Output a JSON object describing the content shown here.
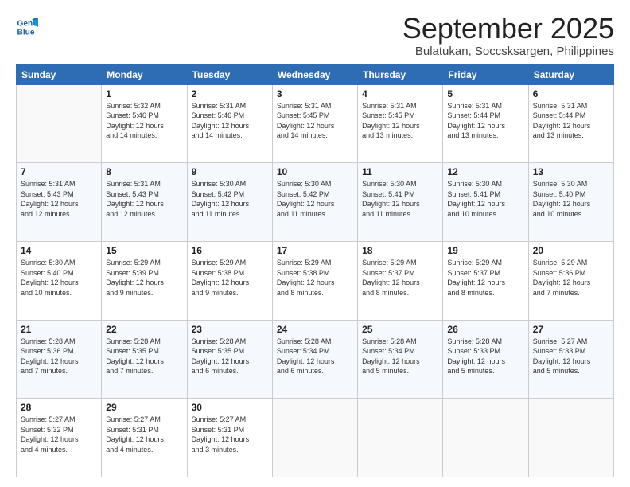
{
  "logo": {
    "line1": "General",
    "line2": "Blue"
  },
  "title": "September 2025",
  "subtitle": "Bulatukan, Soccsksargen, Philippines",
  "days_header": [
    "Sunday",
    "Monday",
    "Tuesday",
    "Wednesday",
    "Thursday",
    "Friday",
    "Saturday"
  ],
  "weeks": [
    [
      {
        "num": "",
        "info": ""
      },
      {
        "num": "1",
        "info": "Sunrise: 5:32 AM\nSunset: 5:46 PM\nDaylight: 12 hours\nand 14 minutes."
      },
      {
        "num": "2",
        "info": "Sunrise: 5:31 AM\nSunset: 5:46 PM\nDaylight: 12 hours\nand 14 minutes."
      },
      {
        "num": "3",
        "info": "Sunrise: 5:31 AM\nSunset: 5:45 PM\nDaylight: 12 hours\nand 14 minutes."
      },
      {
        "num": "4",
        "info": "Sunrise: 5:31 AM\nSunset: 5:45 PM\nDaylight: 12 hours\nand 13 minutes."
      },
      {
        "num": "5",
        "info": "Sunrise: 5:31 AM\nSunset: 5:44 PM\nDaylight: 12 hours\nand 13 minutes."
      },
      {
        "num": "6",
        "info": "Sunrise: 5:31 AM\nSunset: 5:44 PM\nDaylight: 12 hours\nand 13 minutes."
      }
    ],
    [
      {
        "num": "7",
        "info": "Sunrise: 5:31 AM\nSunset: 5:43 PM\nDaylight: 12 hours\nand 12 minutes."
      },
      {
        "num": "8",
        "info": "Sunrise: 5:31 AM\nSunset: 5:43 PM\nDaylight: 12 hours\nand 12 minutes."
      },
      {
        "num": "9",
        "info": "Sunrise: 5:30 AM\nSunset: 5:42 PM\nDaylight: 12 hours\nand 11 minutes."
      },
      {
        "num": "10",
        "info": "Sunrise: 5:30 AM\nSunset: 5:42 PM\nDaylight: 12 hours\nand 11 minutes."
      },
      {
        "num": "11",
        "info": "Sunrise: 5:30 AM\nSunset: 5:41 PM\nDaylight: 12 hours\nand 11 minutes."
      },
      {
        "num": "12",
        "info": "Sunrise: 5:30 AM\nSunset: 5:41 PM\nDaylight: 12 hours\nand 10 minutes."
      },
      {
        "num": "13",
        "info": "Sunrise: 5:30 AM\nSunset: 5:40 PM\nDaylight: 12 hours\nand 10 minutes."
      }
    ],
    [
      {
        "num": "14",
        "info": "Sunrise: 5:30 AM\nSunset: 5:40 PM\nDaylight: 12 hours\nand 10 minutes."
      },
      {
        "num": "15",
        "info": "Sunrise: 5:29 AM\nSunset: 5:39 PM\nDaylight: 12 hours\nand 9 minutes."
      },
      {
        "num": "16",
        "info": "Sunrise: 5:29 AM\nSunset: 5:38 PM\nDaylight: 12 hours\nand 9 minutes."
      },
      {
        "num": "17",
        "info": "Sunrise: 5:29 AM\nSunset: 5:38 PM\nDaylight: 12 hours\nand 8 minutes."
      },
      {
        "num": "18",
        "info": "Sunrise: 5:29 AM\nSunset: 5:37 PM\nDaylight: 12 hours\nand 8 minutes."
      },
      {
        "num": "19",
        "info": "Sunrise: 5:29 AM\nSunset: 5:37 PM\nDaylight: 12 hours\nand 8 minutes."
      },
      {
        "num": "20",
        "info": "Sunrise: 5:29 AM\nSunset: 5:36 PM\nDaylight: 12 hours\nand 7 minutes."
      }
    ],
    [
      {
        "num": "21",
        "info": "Sunrise: 5:28 AM\nSunset: 5:36 PM\nDaylight: 12 hours\nand 7 minutes."
      },
      {
        "num": "22",
        "info": "Sunrise: 5:28 AM\nSunset: 5:35 PM\nDaylight: 12 hours\nand 7 minutes."
      },
      {
        "num": "23",
        "info": "Sunrise: 5:28 AM\nSunset: 5:35 PM\nDaylight: 12 hours\nand 6 minutes."
      },
      {
        "num": "24",
        "info": "Sunrise: 5:28 AM\nSunset: 5:34 PM\nDaylight: 12 hours\nand 6 minutes."
      },
      {
        "num": "25",
        "info": "Sunrise: 5:28 AM\nSunset: 5:34 PM\nDaylight: 12 hours\nand 5 minutes."
      },
      {
        "num": "26",
        "info": "Sunrise: 5:28 AM\nSunset: 5:33 PM\nDaylight: 12 hours\nand 5 minutes."
      },
      {
        "num": "27",
        "info": "Sunrise: 5:27 AM\nSunset: 5:33 PM\nDaylight: 12 hours\nand 5 minutes."
      }
    ],
    [
      {
        "num": "28",
        "info": "Sunrise: 5:27 AM\nSunset: 5:32 PM\nDaylight: 12 hours\nand 4 minutes."
      },
      {
        "num": "29",
        "info": "Sunrise: 5:27 AM\nSunset: 5:31 PM\nDaylight: 12 hours\nand 4 minutes."
      },
      {
        "num": "30",
        "info": "Sunrise: 5:27 AM\nSunset: 5:31 PM\nDaylight: 12 hours\nand 3 minutes."
      },
      {
        "num": "",
        "info": ""
      },
      {
        "num": "",
        "info": ""
      },
      {
        "num": "",
        "info": ""
      },
      {
        "num": "",
        "info": ""
      }
    ]
  ]
}
